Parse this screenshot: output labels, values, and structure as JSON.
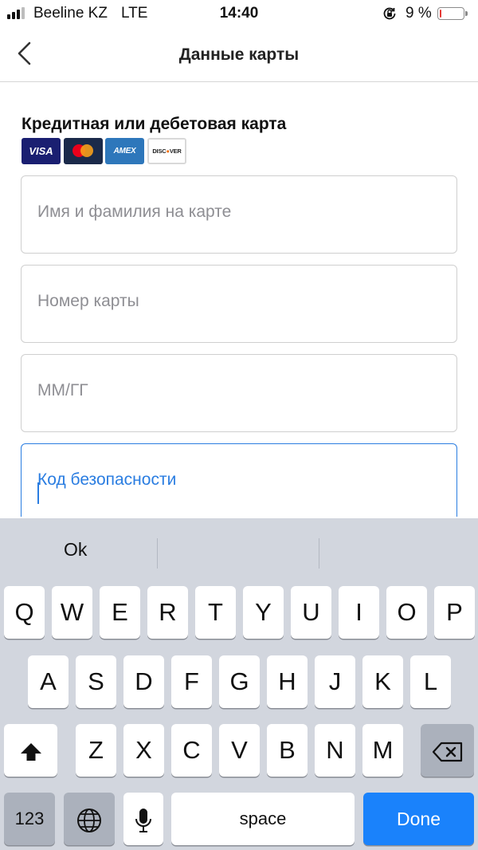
{
  "status_bar": {
    "carrier": "Beeline KZ",
    "network": "LTE",
    "time": "14:40",
    "battery_percent": "9 %",
    "battery_level": 0.09,
    "battery_color": "#e53935"
  },
  "nav": {
    "title": "Данные карты",
    "back_icon": "chevron-left-icon"
  },
  "form": {
    "section_title": "Кредитная или дебетовая карта",
    "card_brands": [
      "VISA",
      "MasterCard",
      "AMEX",
      "DISCOVER"
    ],
    "fields": [
      {
        "placeholder": "Имя и фамилия на карте",
        "value": ""
      },
      {
        "placeholder": "Номер карты",
        "value": ""
      },
      {
        "placeholder": "ММ/ГГ",
        "value": ""
      },
      {
        "placeholder": "Код безопасности",
        "value": "",
        "focused": true
      }
    ],
    "accent_color": "#2a7de1"
  },
  "keyboard": {
    "suggestions": [
      "Ok",
      "",
      ""
    ],
    "row1": [
      "Q",
      "W",
      "E",
      "R",
      "T",
      "Y",
      "U",
      "I",
      "O",
      "P"
    ],
    "row2": [
      "A",
      "S",
      "D",
      "F",
      "G",
      "H",
      "J",
      "K",
      "L"
    ],
    "row3": [
      "Z",
      "X",
      "C",
      "V",
      "B",
      "N",
      "M"
    ],
    "numbers_label": "123",
    "space_label": "space",
    "done_label": "Done",
    "done_color": "#1a82fb"
  }
}
